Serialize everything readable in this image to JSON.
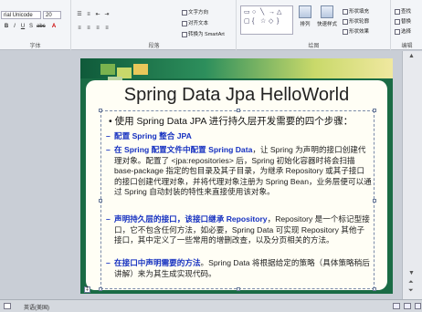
{
  "ribbon": {
    "font_name": "rial Unicode",
    "font_size": "20",
    "font_group_label": "字体",
    "paragraph_group_label": "段落",
    "text_direction": "文字方向",
    "align_text": "对齐文本",
    "convert_smartart": "转换为 SmartArt",
    "arrange_label": "排列",
    "quick_styles_label": "快速样式",
    "shape_fill": "形状填充",
    "shape_outline": "形状轮廓",
    "shape_effects": "形状效果",
    "drawing_group_label": "绘图",
    "find": "查找",
    "replace": "替换",
    "select": "选择",
    "editing_group_label": "编辑"
  },
  "slide": {
    "title": "Spring Data Jpa HelloWorld",
    "bullet": "使用 Spring Data JPA 进行持久层开发需要的四个步骤：",
    "steps": [
      {
        "lead": "配置 Spring 整合 JPA",
        "rest": ""
      },
      {
        "lead": "在 Spring 配置文件中配置 Spring Data",
        "rest": "，让 Spring 为声明的接口创建代理对象。配置了 <jpa:repositories> 后，Spring 初始化容器时将会扫描 base-package 指定的包目录及其子目录，为继承 Repository 或其子接口的接口创建代理对象，并将代理对象注册为 Spring Bean，业务层便可以通过 Spring 自动封装的特性来直接使用该对象。"
      },
      {
        "lead": "声明持久层的接口，该接口继承  Repository",
        "rest": "，Repository 是一个标记型接口，它不包含任何方法，如必要，Spring Data 可实现 Repository 其他子接口，其中定义了一些常用的增删改查，以及分页相关的方法。"
      },
      {
        "lead": "在接口中声明需要的方法",
        "rest": "。Spring Data 将根据给定的策略（具体策略稍后讲解）来为其生成实现代码。"
      }
    ]
  },
  "status": {
    "language": "英语(美国)"
  },
  "colors": {
    "slide_green": "#1a6b45",
    "step_blue": "#1530c0"
  }
}
